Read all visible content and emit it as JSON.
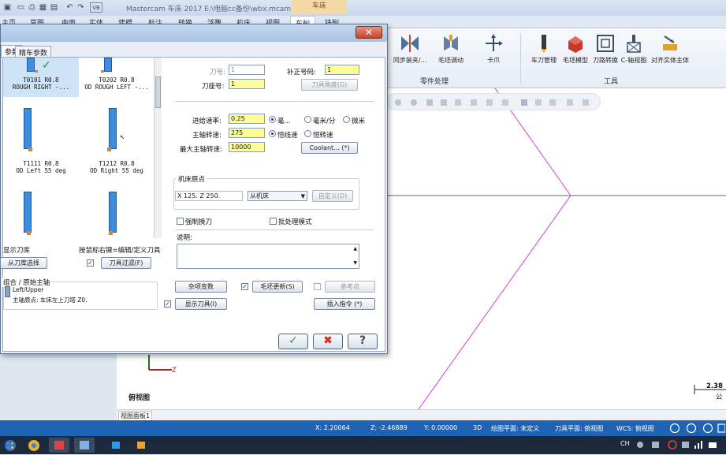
{
  "app": {
    "title": "Mastercam 车床 2017  E:\\电脑cc备份\\wbx.mcam",
    "context_tab": "车床"
  },
  "ribbon_tabs": [
    "主页",
    "草图",
    "曲面",
    "实体",
    "建模",
    "标注",
    "转换",
    "浮雕",
    "机床",
    "视图",
    "车削",
    "铣削"
  ],
  "ribbon": {
    "group1": {
      "label": "零件处理",
      "buttons": [
        "同步装夹/...",
        "毛坯调动",
        "卡爪"
      ]
    },
    "group2": {
      "label": "工具",
      "buttons": [
        "车刀管理",
        "毛坯模型",
        "刀路转换",
        "C-轴视图",
        "对齐实体主体"
      ]
    }
  },
  "dialog": {
    "tabs": [
      "参数",
      "精车参数"
    ],
    "tools": [
      {
        "id": "T0101 R0.8",
        "desc": "ROUGH RIGHT -..."
      },
      {
        "id": "T0202 R0.8",
        "desc": "OD ROUGH LEFT -..."
      },
      {
        "id": "T1111 R0.8",
        "desc": "OD Left 55 deg"
      },
      {
        "id": "T1212 R0.8",
        "desc": "OD Right 55 deg"
      }
    ],
    "tool_fields": {
      "tool_no_label": "刀号:",
      "tool_no_value": "1",
      "offset_label": "补正号码:",
      "offset_value": "1",
      "holder_label": "刀座号:",
      "holder_value": "1",
      "tool_angle_button": "刀具角度(G)"
    },
    "cutting": {
      "feed_label": "进给速率:",
      "feed_value": "0.25",
      "feed_opt1": "毫...",
      "feed_opt2": "毫米/分",
      "feed_opt3": "微米",
      "spindle_label": "主轴转速:",
      "spindle_value": "275",
      "spindle_opt1": "恒线速",
      "spindle_opt2": "恒转速",
      "max_spindle_label": "最大主轴转速:",
      "max_spindle_value": "10000",
      "coolant_button": "Coolant... (*)"
    },
    "home": {
      "group_label": "机床原点",
      "coords": "X 125.  Z 250.",
      "mode": "从机床",
      "define_button": "自定义(D)"
    },
    "force_tool_change": "强制换刀",
    "batch_mode": "批处理模式",
    "notes_label": "说明:",
    "library": {
      "show_library": "显示刀库",
      "right_click_hint": "按鼠标右键=编辑/定义刀具",
      "select_from_library": "从刀库选择",
      "tool_filter": "刀具过滤(F)"
    },
    "spindle_group": {
      "label": "组合 / 原始主轴",
      "line1": "Left/Upper",
      "line2": "主轴原点: 车床左上刀塔    Z0."
    },
    "buttons": {
      "misc_values": "杂项变数",
      "stock_update": "毛坯更新(S)",
      "ref_point": "参考点",
      "show_tool": "显示刀具(I)",
      "insert_cmd": "插入指令 (*)"
    },
    "ok_icon": "check-icon",
    "cancel_icon": "cross-icon",
    "help_icon": "help-icon"
  },
  "viewport": {
    "view_label": "俯视图",
    "axis_z": "Z",
    "scale_value": "2.38",
    "scale_unit": "公",
    "bottom_tab": "视图面板1"
  },
  "statusbar": {
    "x": "X:  2.20064",
    "z": "Z:  -2.46889",
    "y": "Y:  0.00000",
    "mode": "3D",
    "plane": "绘图平面: 未定义",
    "tool_plane": "刀具平面: 俯视图",
    "wcs": "WCS: 俯视图"
  },
  "taskbar": {
    "tray_text": "CH"
  },
  "colors": {
    "accent": "#1e63b4",
    "tool_blue": "#3c8ddc",
    "highlight_yellow": "#ffff9a",
    "toolpath_magenta": "#d040d8"
  }
}
